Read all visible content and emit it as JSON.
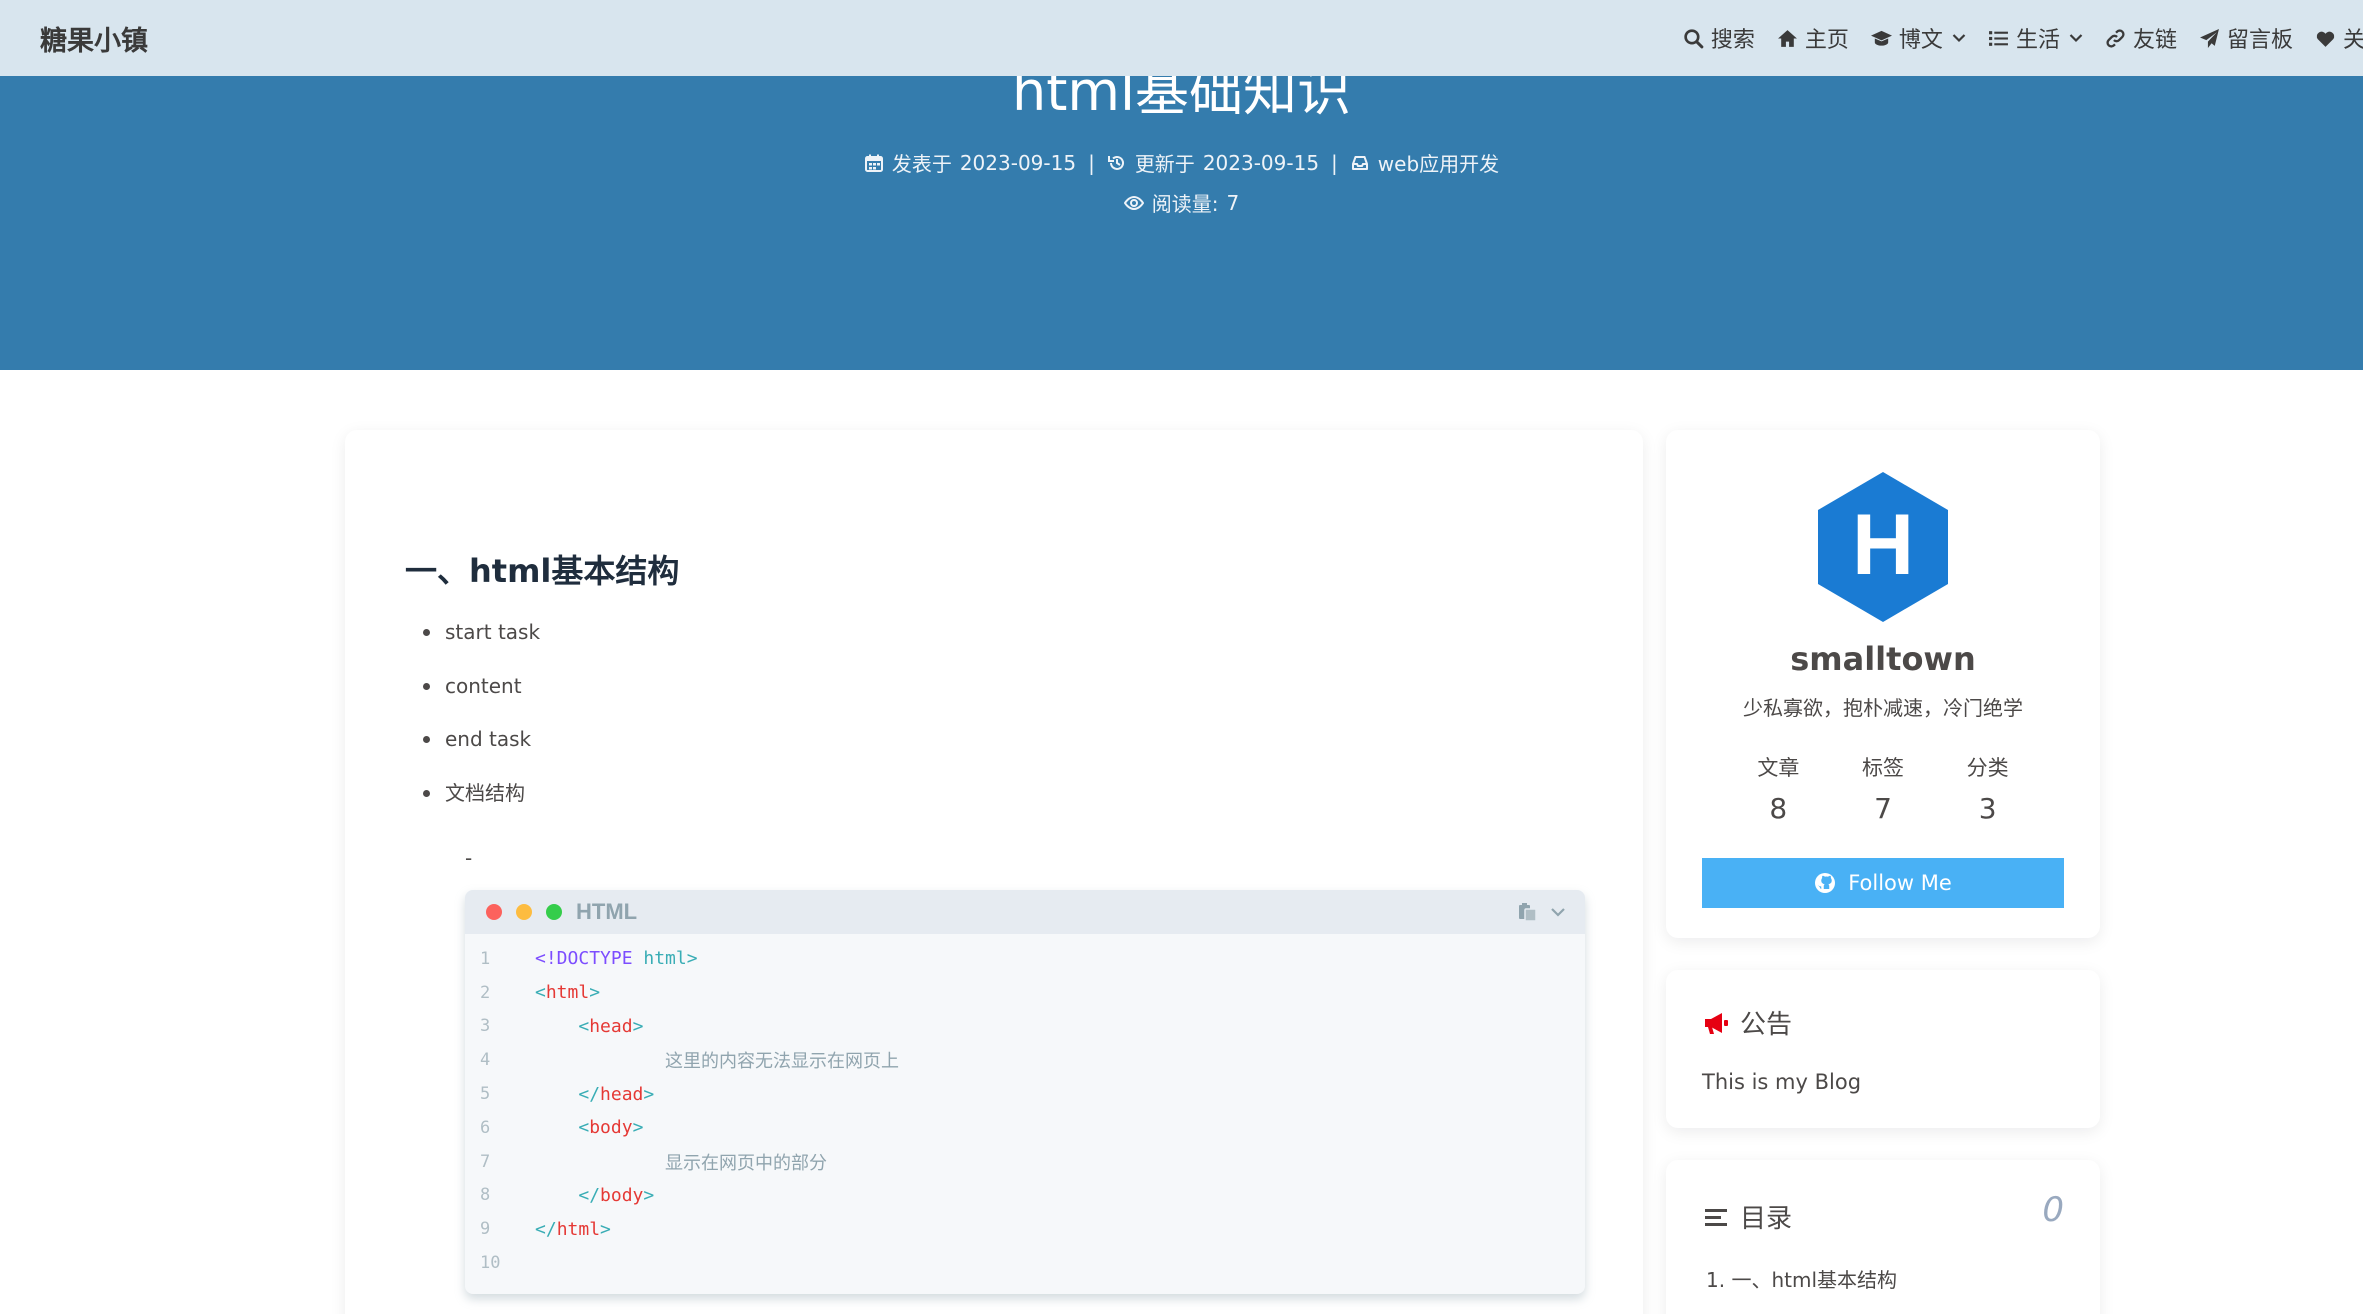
{
  "site": {
    "name": "糖果小镇"
  },
  "nav": {
    "items": [
      {
        "label": "搜索",
        "icon": "search-icon",
        "dropdown": false
      },
      {
        "label": "主页",
        "icon": "home-icon",
        "dropdown": false
      },
      {
        "label": "博文",
        "icon": "graduation-cap-icon",
        "dropdown": true
      },
      {
        "label": "生活",
        "icon": "list-icon",
        "dropdown": true
      },
      {
        "label": "友链",
        "icon": "link-icon",
        "dropdown": false
      },
      {
        "label": "留言板",
        "icon": "paper-plane-icon",
        "dropdown": false
      },
      {
        "label": "关于",
        "icon": "heart-icon",
        "dropdown": false
      }
    ]
  },
  "post": {
    "title": "html基础知识",
    "meta": {
      "published_label": "发表于",
      "published_date": "2023-09-15",
      "updated_label": "更新于",
      "updated_date": "2023-09-15",
      "category": "web应用开发",
      "views_label": "阅读量:",
      "views": "7",
      "separator": "|"
    },
    "heading": "一、html基本结构",
    "list": [
      "start task",
      "content",
      "end task",
      "文档结构"
    ],
    "dash": "-",
    "code": {
      "language": "HTML",
      "line_numbers": [
        "1",
        "2",
        "3",
        "4",
        "5",
        "6",
        "7",
        "8",
        "9",
        "10"
      ],
      "lines": [
        {
          "open": "<",
          "tag": "!DOCTYPE",
          "attr": " html",
          "close": ">",
          "indent": "",
          "text": ""
        },
        {
          "open": "<",
          "tag": "html",
          "close": ">",
          "indent": ""
        },
        {
          "open": "<",
          "tag": "head",
          "close": ">",
          "indent": "    "
        },
        {
          "indent": "",
          "text": "这里的内容无法显示在网页上"
        },
        {
          "open": "</",
          "tag": "head",
          "close": ">",
          "indent": "    "
        },
        {
          "open": "<",
          "tag": "body",
          "close": ">",
          "indent": "    "
        },
        {
          "indent": "",
          "text": "显示在网页中的部分"
        },
        {
          "open": "</",
          "tag": "body",
          "close": ">",
          "indent": "    "
        },
        {
          "open": "</",
          "tag": "html",
          "close": ">",
          "indent": ""
        },
        {
          "indent": "",
          "text": ""
        }
      ]
    }
  },
  "author": {
    "avatar_letter": "H",
    "name": "smalltown",
    "description": "少私寡欲，抱朴减速，冷门绝学",
    "stats": [
      {
        "label": "文章",
        "value": "8"
      },
      {
        "label": "标签",
        "value": "7"
      },
      {
        "label": "分类",
        "value": "3"
      }
    ],
    "follow_label": "Follow Me"
  },
  "announcement": {
    "title": "公告",
    "text": "This is my Blog"
  },
  "toc": {
    "title": "目录",
    "percent": "0",
    "items": [
      "1. 一、html基本结构"
    ]
  },
  "colors": {
    "navbar": "#d8e5ee",
    "hero": "#347cad",
    "follow_button": "#49b1f5",
    "avatar": "#1a7bd3",
    "announce_icon": "#e60012"
  }
}
